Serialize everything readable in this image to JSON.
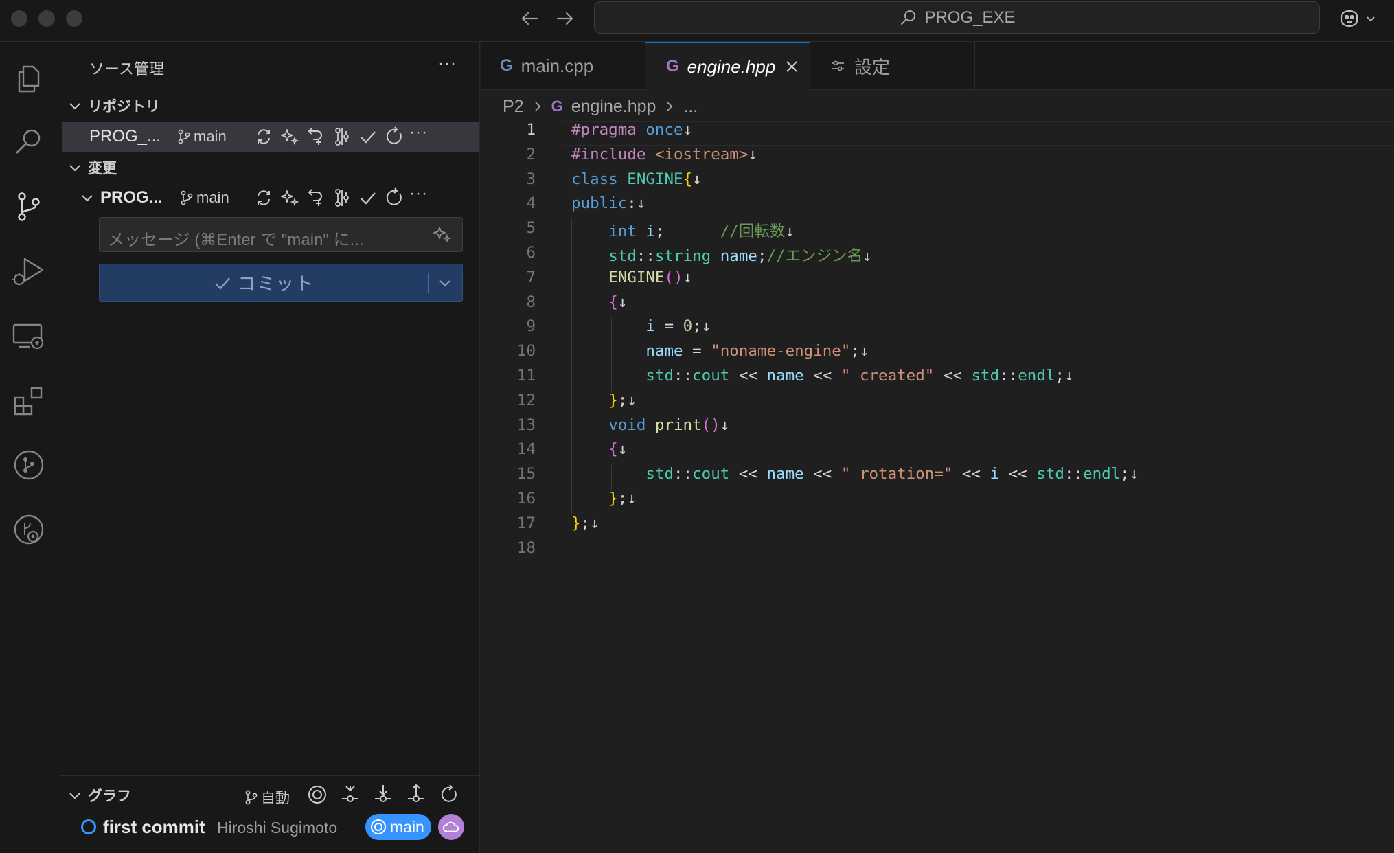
{
  "titlebar": {
    "command_center": "PROG_EXE"
  },
  "sidebar": {
    "title": "ソース管理",
    "more": "···",
    "repositories_header": "リポジトリ",
    "repo": {
      "name": "PROG_...",
      "branch": "main"
    },
    "changes_header": "変更",
    "changes_repo": {
      "name": "PROG...",
      "branch": "main"
    },
    "message_placeholder": "メッセージ (⌘Enter で \"main\" に...",
    "commit_label": "コミット",
    "graph": {
      "header": "グラフ",
      "branch_mode": "自動",
      "commit_message": "first commit",
      "commit_author": "Hiroshi Sugimoto",
      "commit_branch": "main"
    }
  },
  "tabs": [
    {
      "label": "main.cpp",
      "active": false
    },
    {
      "label": "engine.hpp",
      "active": true
    },
    {
      "label": "設定",
      "active": false
    }
  ],
  "breadcrumb": [
    "P2",
    "engine.hpp",
    "..."
  ],
  "editor": {
    "current_line": 1,
    "line_numbers": [
      "1",
      "2",
      "3",
      "4",
      "5",
      "6",
      "7",
      "8",
      "9",
      "10",
      "11",
      "12",
      "13",
      "14",
      "15",
      "16",
      "17",
      "18"
    ],
    "lines": [
      "#pragma once↓",
      "#include <iostream>↓",
      "class ENGINE{↓",
      "public:↓",
      "    int i;      //回転数↓",
      "    std::string name;//エンジン名↓",
      "    ENGINE()↓",
      "    {↓",
      "        i = 0;↓",
      "        name = \"noname-engine\";↓",
      "        std::cout << name << \" created\" << std::endl;↓",
      "    };↓",
      "    void print()↓",
      "    {↓",
      "        std::cout << name << \" rotation=\" << i << std::endl;↓",
      "    };↓",
      "};↓",
      ""
    ]
  }
}
